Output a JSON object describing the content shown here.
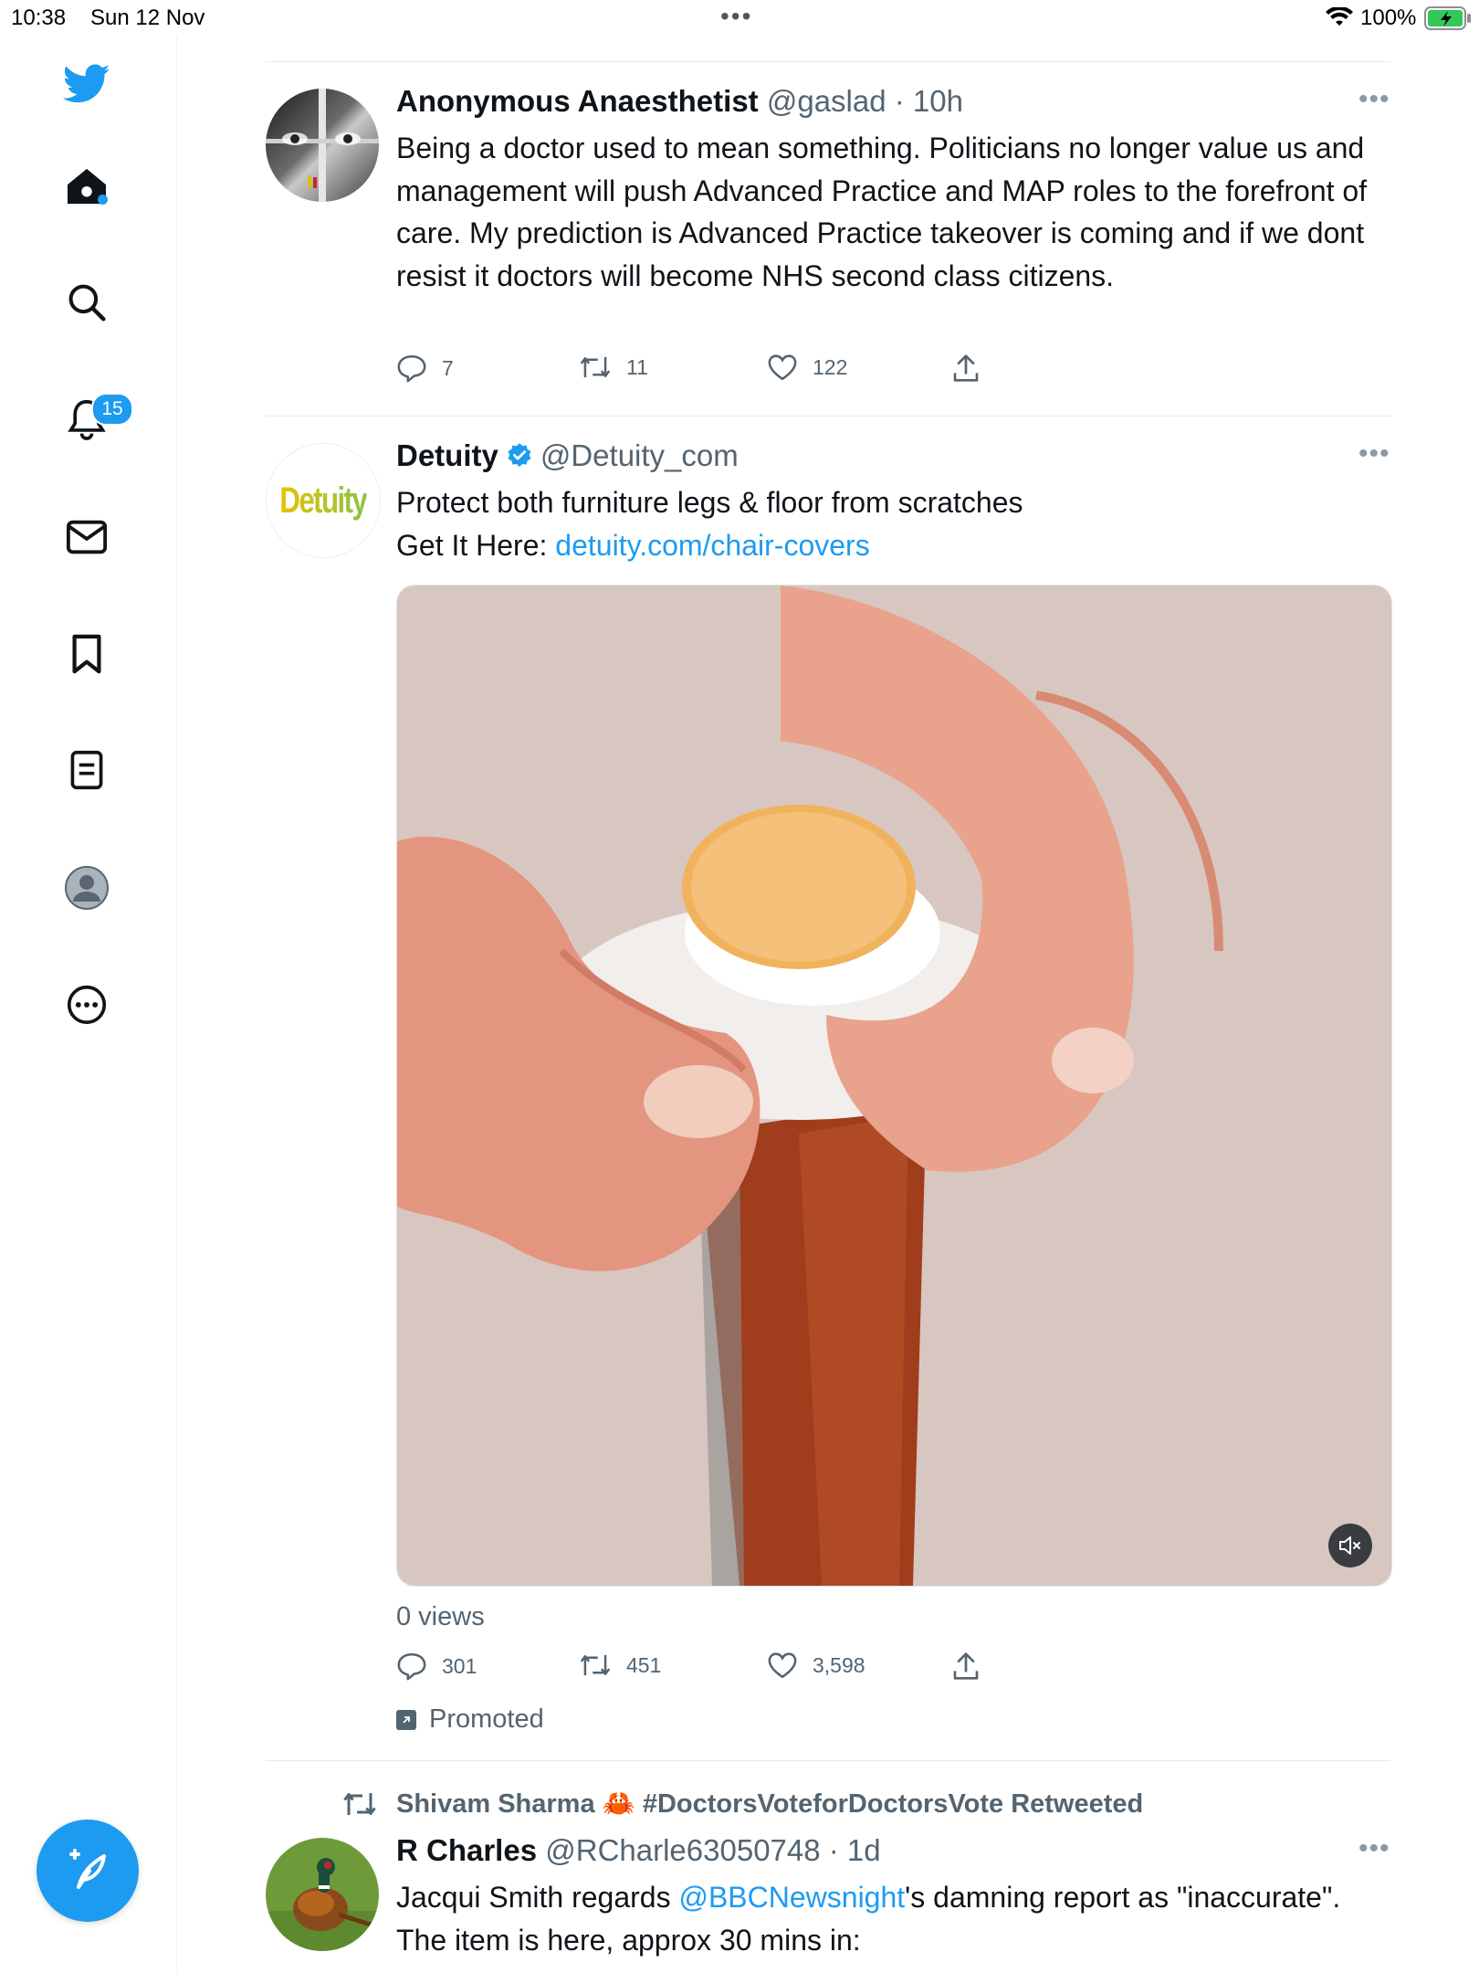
{
  "status_bar": {
    "time": "10:38",
    "date": "Sun 12 Nov",
    "dots": "•••",
    "battery": "100%"
  },
  "sidebar": {
    "items": [
      {
        "name": "home",
        "icon": "home-icon"
      },
      {
        "name": "explore",
        "icon": "search-icon"
      },
      {
        "name": "notifications",
        "icon": "bell-icon",
        "badge": "15"
      },
      {
        "name": "messages",
        "icon": "mail-icon"
      },
      {
        "name": "bookmarks",
        "icon": "bookmark-icon"
      },
      {
        "name": "lists",
        "icon": "list-icon"
      },
      {
        "name": "profile",
        "icon": "profile-icon"
      },
      {
        "name": "more",
        "icon": "more-circle-icon"
      }
    ],
    "accent_color": "#1d9bf0"
  },
  "tweets": [
    {
      "name": "Anonymous Anaesthetist",
      "handle": "@gaslad",
      "time": " · 10h",
      "text": "Being a doctor used to mean something. Politicians no longer value us and management will push Advanced Practice and MAP roles to the forefront of care. My prediction is Advanced Practice takeover is coming and if we dont resist it doctors will become NHS second class citizens.",
      "replies": "7",
      "retweets": "11",
      "likes": "122"
    },
    {
      "name": "Detuity",
      "handle": "@Detuity_com",
      "avatar_text": "Detuity",
      "text_line1": "Protect both furniture legs & floor from scratches",
      "text_line2": "Get It Here: ",
      "link": "detuity.com/chair-covers",
      "views": "0 views",
      "replies": "301",
      "retweets": "451",
      "likes": "3,598",
      "promoted": "Promoted"
    },
    {
      "retweeted_by": "Shivam Sharma 🦀 #DoctorsVoteforDoctorsVote Retweeted",
      "name": "R Charles",
      "handle": "@RCharle63050748",
      "time": " · 1d",
      "text_part1": "Jacqui Smith regards ",
      "mention": "@BBCNewsnight",
      "text_part2": "'s damning report  as \"inaccurate\". The item is here, approx 30 mins in:"
    }
  ]
}
